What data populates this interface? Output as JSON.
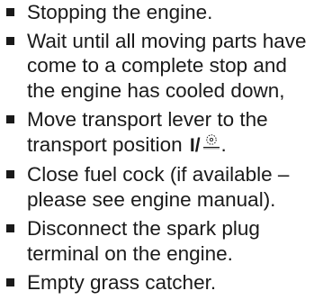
{
  "steps": [
    {
      "lines": [
        "Stopping the engine."
      ]
    },
    {
      "lines": [
        "Wait until all moving parts have",
        "come to a complete stop and",
        "the engine has cooled down,"
      ]
    },
    {
      "lines": [
        "Move transport lever to the",
        "transport position"
      ],
      "symbol_text": "I/",
      "symbol_icon": "wheel-transport-icon"
    },
    {
      "lines": [
        "Close fuel cock (if available –",
        "please see engine manual)."
      ]
    },
    {
      "lines": [
        "Disconnect the spark plug",
        "terminal on the engine."
      ]
    },
    {
      "lines": [
        "Empty grass catcher."
      ]
    }
  ],
  "colors": {
    "text": "#1a1a1a",
    "bullet": "#1a1a1a",
    "background": "#ffffff"
  }
}
